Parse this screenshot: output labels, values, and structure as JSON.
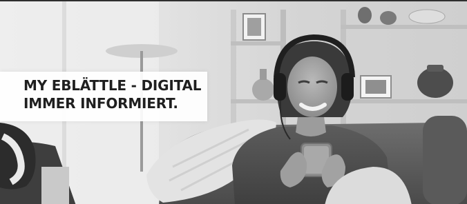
{
  "banner": {
    "headline_line1": "MY EBLÄTTLE - DIGITAL",
    "headline_line2": "IMMER INFORMIERT."
  },
  "photo": {
    "subject": "woman-with-headphones-using-smartphone",
    "palette": "grayscale"
  }
}
